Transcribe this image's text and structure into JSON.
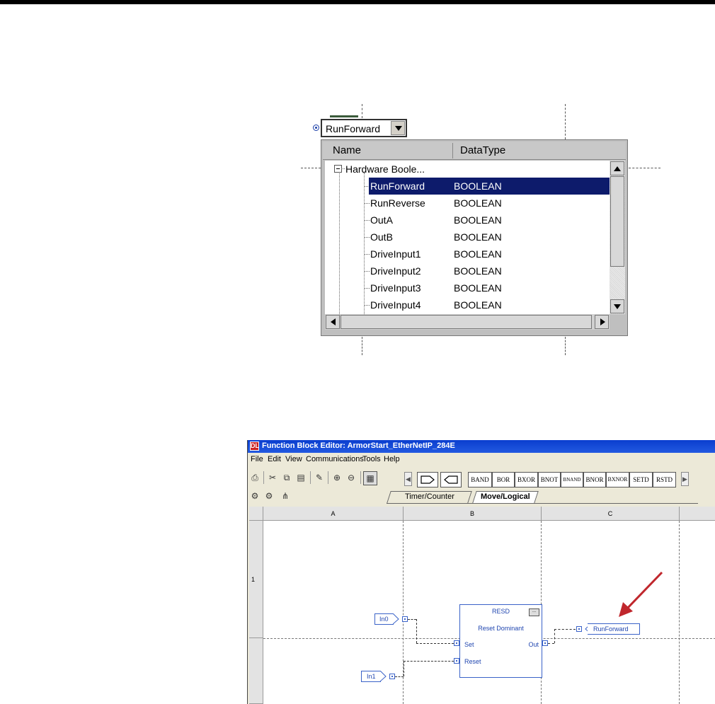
{
  "dropdown": {
    "selected_value": "RunForward",
    "columns": {
      "name": "Name",
      "datatype": "DataType"
    },
    "group_label": "Hardware Boole...",
    "rows": [
      {
        "name": "RunForward",
        "type": "BOOLEAN",
        "selected": true
      },
      {
        "name": "RunReverse",
        "type": "BOOLEAN"
      },
      {
        "name": "OutA",
        "type": "BOOLEAN"
      },
      {
        "name": "OutB",
        "type": "BOOLEAN"
      },
      {
        "name": "DriveInput1",
        "type": "BOOLEAN"
      },
      {
        "name": "DriveInput2",
        "type": "BOOLEAN"
      },
      {
        "name": "DriveInput3",
        "type": "BOOLEAN"
      },
      {
        "name": "DriveInput4",
        "type": "BOOLEAN"
      }
    ]
  },
  "editor": {
    "title": "Function Block Editor: ArmorStart_EtherNetIP_284E",
    "app_icon": "DL",
    "menu": [
      "File",
      "Edit",
      "View",
      "Communications",
      "Tools",
      "Help"
    ],
    "palette_buttons": [
      "BAND",
      "BOR",
      "BXOR",
      "BNOT",
      "BNAND",
      "BNOR",
      "BXNOR",
      "SETD",
      "RSTD"
    ],
    "tabs": [
      {
        "label": "Timer/Counter",
        "active": false
      },
      {
        "label": "Move/Logical",
        "active": true
      }
    ],
    "columns": [
      "A",
      "B",
      "C"
    ],
    "rows": [
      "1"
    ],
    "block": {
      "name": "RESD",
      "description": "Reset Dominant",
      "more": "...",
      "pins": {
        "set": "Set",
        "reset": "Reset",
        "out": "Out"
      }
    },
    "input_tags": [
      "In0",
      "In1"
    ],
    "output_tag": "RunForward",
    "arrow_color": "#c0272d"
  },
  "colors": {
    "selection": "#0d1b6b",
    "fbd_blue": "#2046b0",
    "title_blue": "#0a3ecf"
  }
}
